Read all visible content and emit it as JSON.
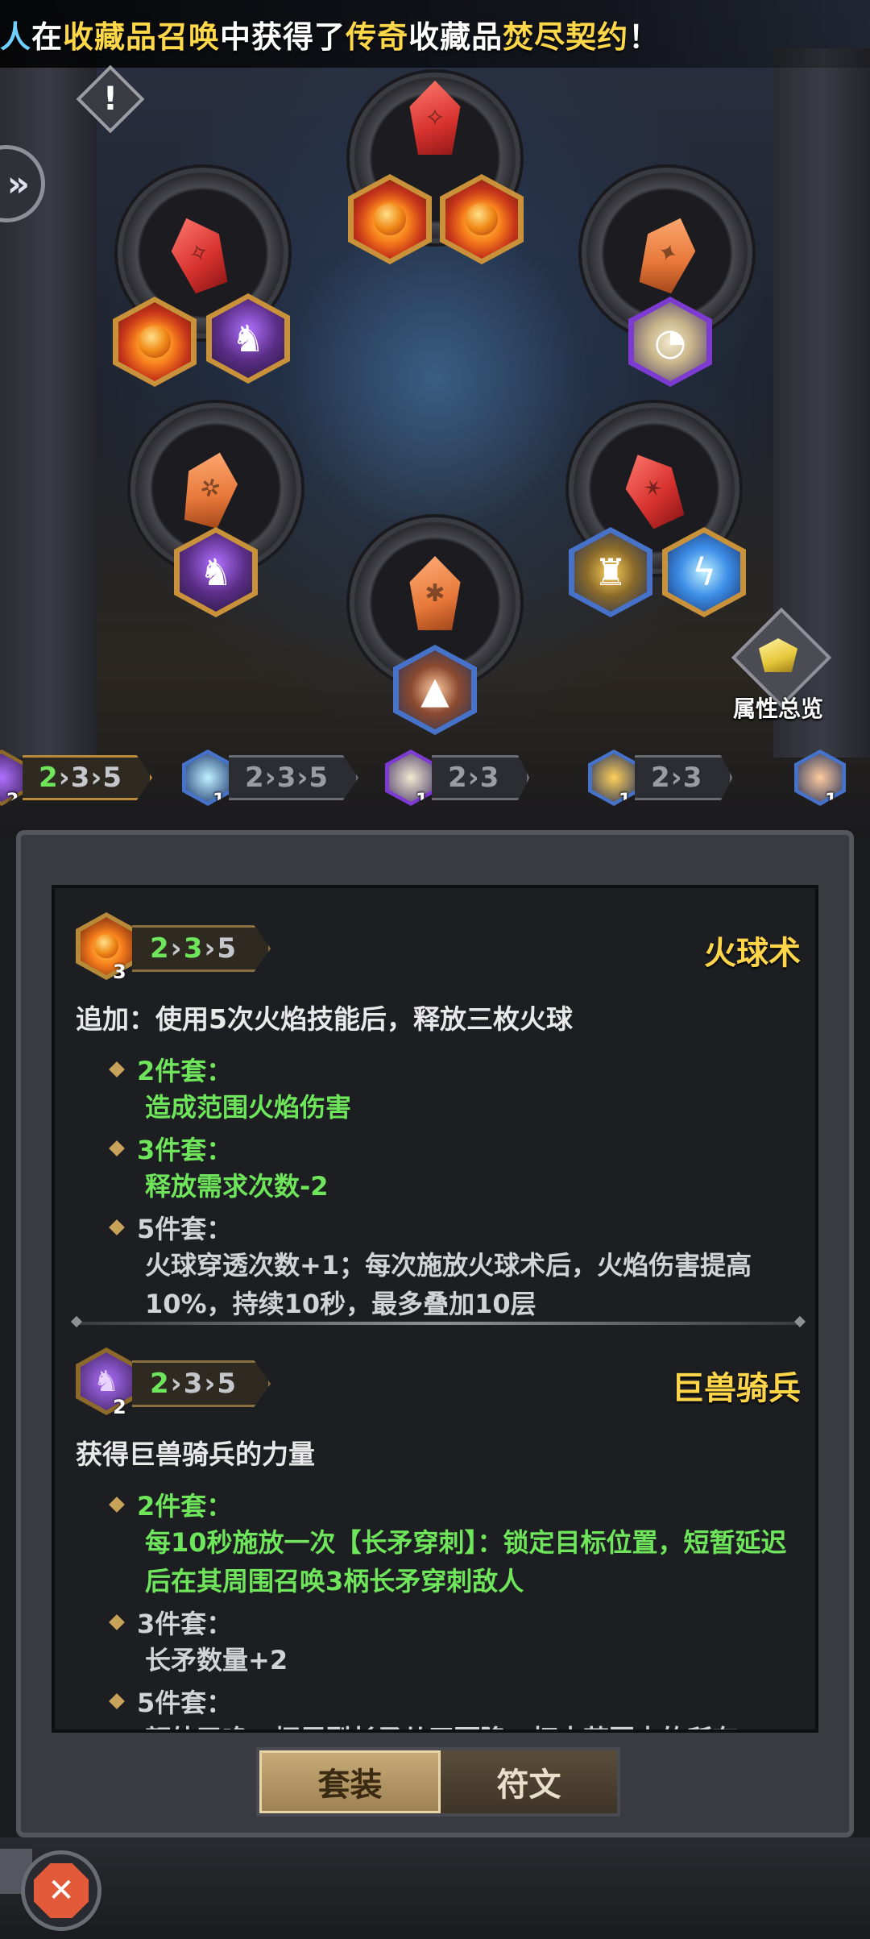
{
  "banner": {
    "lead_char": "人",
    "parts": [
      {
        "text": "在",
        "color": "white"
      },
      {
        "text": "收藏品召唤",
        "color": "yellow"
      },
      {
        "text": "中获得了",
        "color": "white"
      },
      {
        "text": "传奇",
        "color": "yellow"
      },
      {
        "text": "收藏品",
        "color": "white"
      },
      {
        "text": "焚尽契约",
        "color": "yellow"
      },
      {
        "text": "！",
        "color": "white"
      }
    ]
  },
  "icons": {
    "warning": "!",
    "side_arrow": "»",
    "close": "✕"
  },
  "summary_button": {
    "label": "属性总览"
  },
  "set_bar": [
    {
      "count": "2",
      "tiers": [
        "2",
        "3",
        "5"
      ],
      "active_upto": 1,
      "icon": "beast"
    },
    {
      "count": "1",
      "tiers": [
        "2",
        "3",
        "5"
      ],
      "active_upto": -1,
      "icon": "lightning"
    },
    {
      "count": "1",
      "tiers": [
        "2",
        "3"
      ],
      "active_upto": -1,
      "icon": "stopwatch"
    },
    {
      "count": "1",
      "tiers": [
        "2",
        "3"
      ],
      "active_upto": -1,
      "icon": "golem"
    },
    {
      "count": "1",
      "tiers": [],
      "active_upto": -1,
      "icon": "rock"
    }
  ],
  "entries": [
    {
      "icon": "fireball",
      "count": "3",
      "tiers": [
        "2",
        "3",
        "5"
      ],
      "name": "火球术",
      "desc": "追加：使用5次火焰技能后，释放三枚火球",
      "bonuses": [
        {
          "label": "2件套：",
          "text": "造成范围火焰伤害",
          "active": true
        },
        {
          "label": "3件套：",
          "text": "释放需求次数-2",
          "active": true
        },
        {
          "label": "5件套：",
          "text": "火球穿透次数+1；每次施放火球术后，火焰伤害提高10%，持续10秒，最多叠加10层",
          "active": false
        }
      ]
    },
    {
      "icon": "beast-rider",
      "count": "2",
      "tiers": [
        "2",
        "3",
        "5"
      ],
      "name": "巨兽骑兵",
      "desc": "获得巨兽骑兵的力量",
      "bonuses": [
        {
          "label": "2件套：",
          "text": "每10秒施放一次【长矛穿刺】：锁定目标位置，短暂延迟后在其周围召唤3柄长矛穿刺敌人",
          "active": true
        },
        {
          "label": "3件套：",
          "text": "长矛数量+2",
          "active": false
        },
        {
          "label": "5件套：",
          "text": "额外召唤一柄巨型长矛从天而降，打击范围内的所有",
          "active": false
        }
      ]
    }
  ],
  "tabs": [
    {
      "label": "套装",
      "active": true
    },
    {
      "label": "符文",
      "active": false
    }
  ],
  "colors": {
    "accent_yellow": "#ffd84a",
    "active_green": "#6ee55a",
    "banner_blue": "#6fd0ff"
  }
}
